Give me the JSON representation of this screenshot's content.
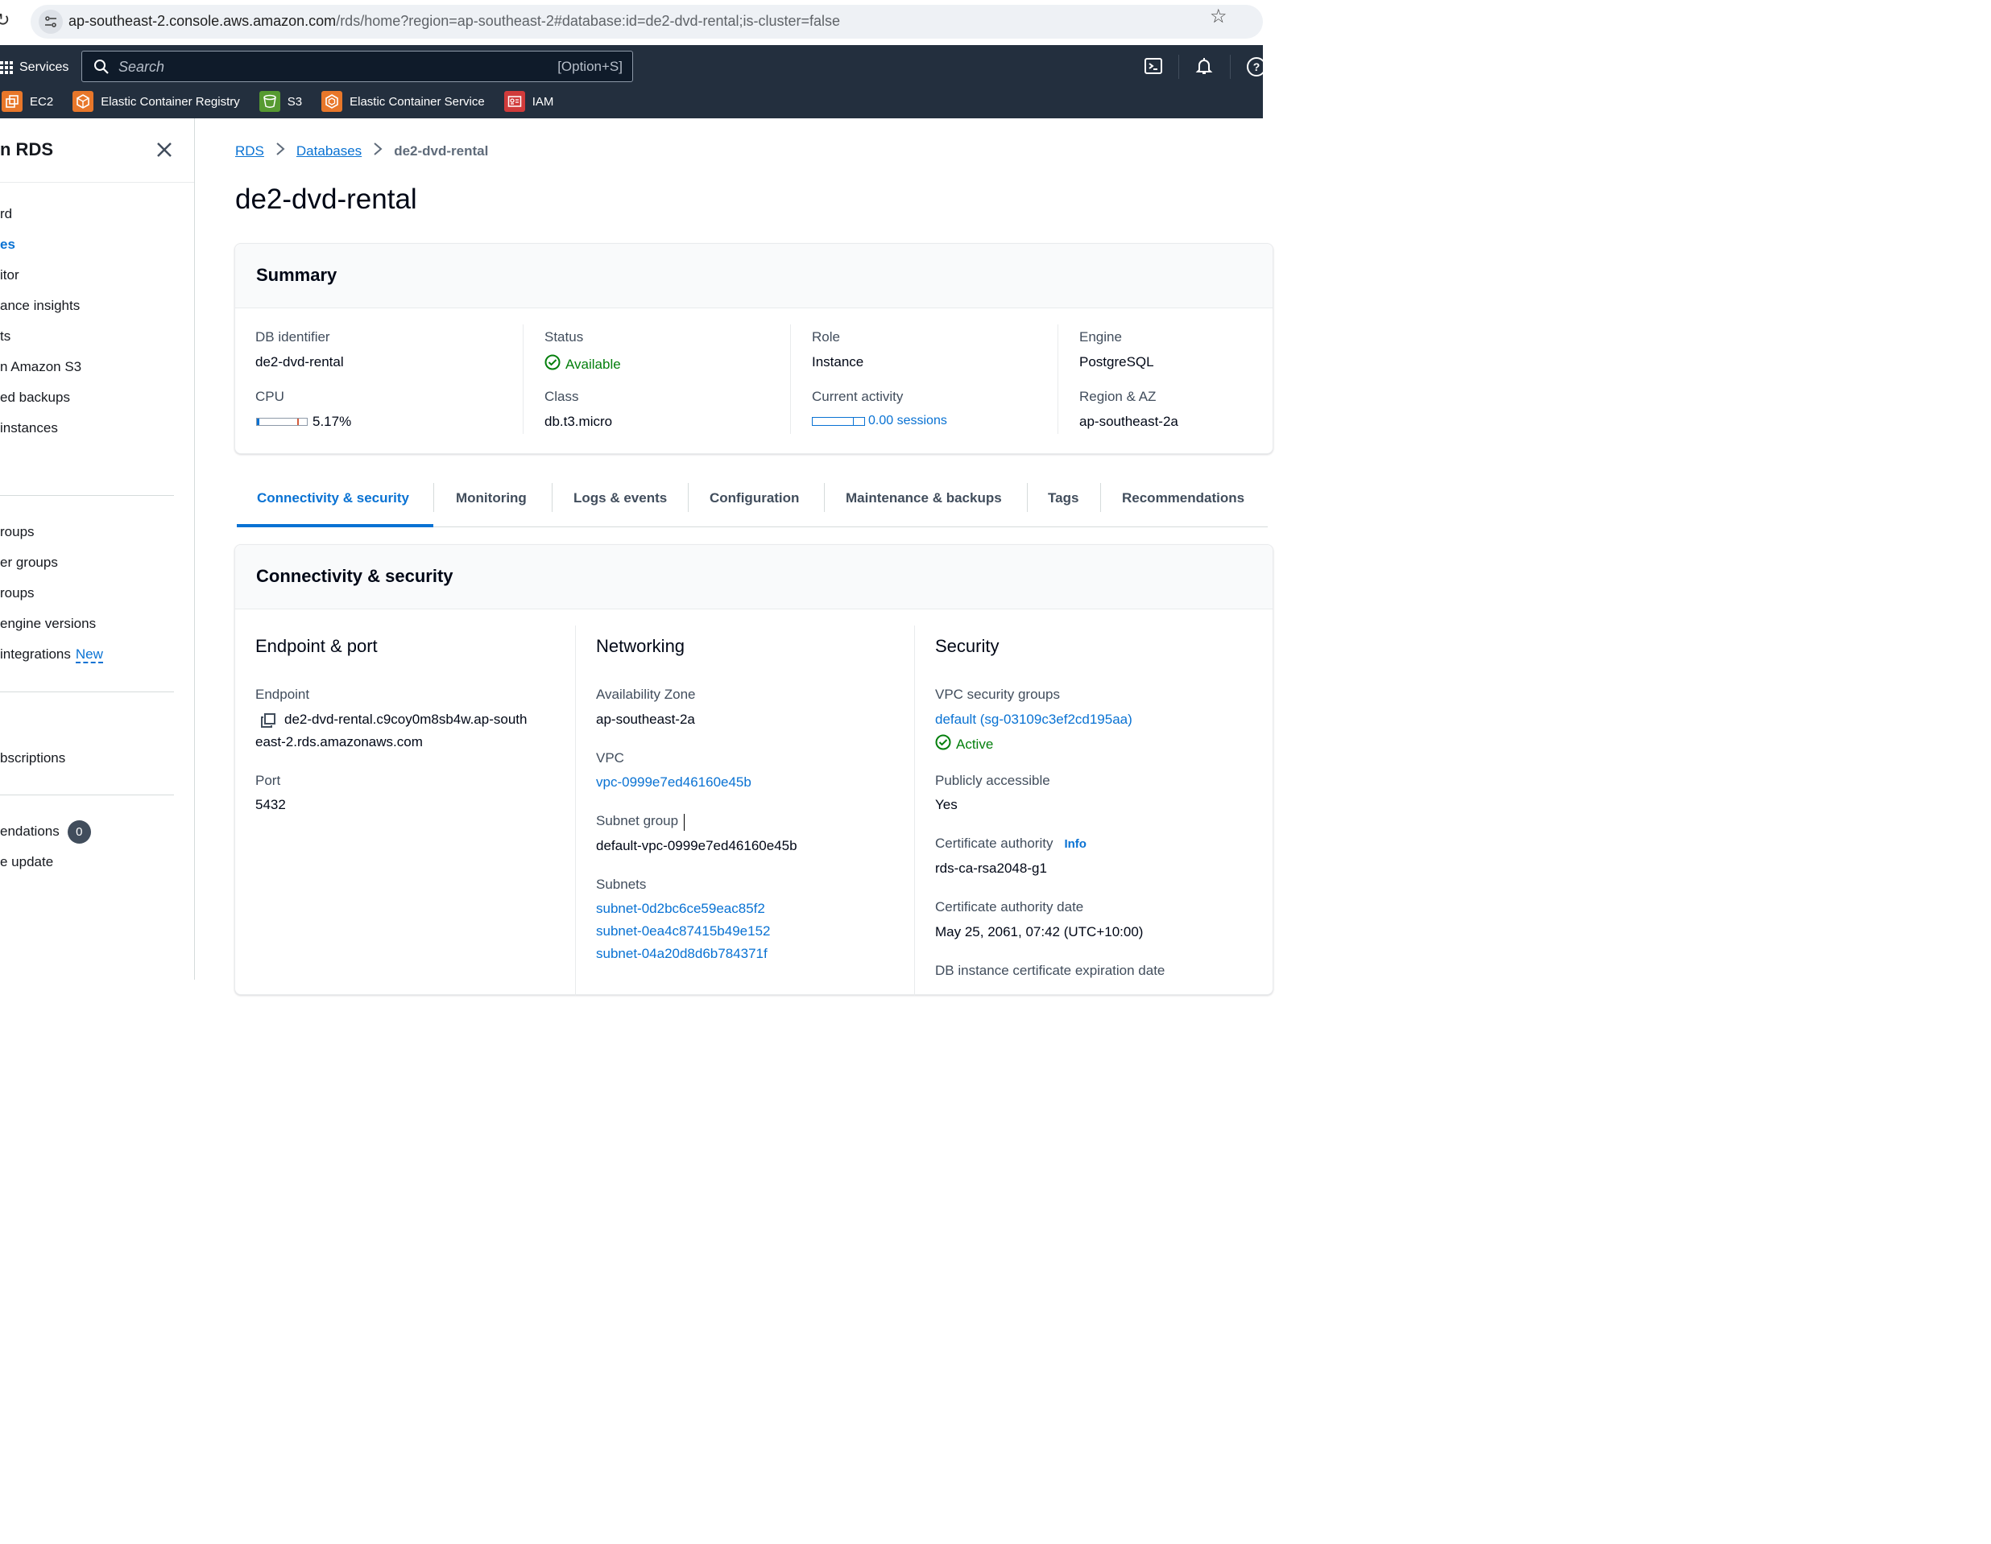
{
  "browser": {
    "url_host": "ap-southeast-2.console.aws.amazon.com",
    "url_path": "/rds/home?region=ap-southeast-2#database:id=de2-dvd-rental;is-cluster=false"
  },
  "topnav": {
    "services_label": "Services",
    "search_placeholder": "Search",
    "search_shortcut": "[Option+S]",
    "favorites": [
      {
        "label": "EC2",
        "icon": "ec2-icon"
      },
      {
        "label": "Elastic Container Registry",
        "icon": "ecr-icon"
      },
      {
        "label": "S3",
        "icon": "s3-bucket-icon"
      },
      {
        "label": "Elastic Container Service",
        "icon": "ecs-icon"
      },
      {
        "label": "IAM",
        "icon": "iam-icon"
      }
    ]
  },
  "sidebar": {
    "title": "n RDS",
    "items": [
      {
        "label": "rd"
      },
      {
        "label": "es",
        "active": true
      },
      {
        "label": "itor"
      },
      {
        "label": "ance insights"
      },
      {
        "label": "ts"
      },
      {
        "label": "n Amazon S3"
      },
      {
        "label": "ed backups"
      },
      {
        "label": " instances"
      },
      {
        "label": "roups"
      },
      {
        "label": "er groups"
      },
      {
        "label": "roups"
      },
      {
        "label": "engine versions"
      },
      {
        "label": " integrations",
        "badge": "New"
      },
      {
        "label": "bscriptions"
      },
      {
        "label": "endations",
        "count": "0"
      },
      {
        "label": "e update"
      }
    ]
  },
  "breadcrumb": {
    "rds": "RDS",
    "databases": "Databases",
    "current": "de2-dvd-rental"
  },
  "page_title": "de2-dvd-rental",
  "summary": {
    "title": "Summary",
    "db_identifier_label": "DB identifier",
    "db_identifier": "de2-dvd-rental",
    "cpu_label": "CPU",
    "cpu_value": "5.17%",
    "cpu_fraction": 0.0517,
    "status_label": "Status",
    "status": "Available",
    "class_label": "Class",
    "class": "db.t3.micro",
    "role_label": "Role",
    "role": "Instance",
    "activity_label": "Current activity",
    "activity": "0.00 sessions",
    "engine_label": "Engine",
    "engine": "PostgreSQL",
    "region_label": "Region & AZ",
    "region": "ap-southeast-2a"
  },
  "tabs": [
    "Connectivity & security",
    "Monitoring",
    "Logs & events",
    "Configuration",
    "Maintenance & backups",
    "Tags",
    "Recommendations"
  ],
  "connectivity": {
    "title": "Connectivity & security",
    "endpoint_section": "Endpoint & port",
    "endpoint_label": "Endpoint",
    "endpoint_line1": "de2-dvd-rental.c9coy0m8sb4w.ap-south",
    "endpoint_line2": "east-2.rds.amazonaws.com",
    "port_label": "Port",
    "port": "5432",
    "networking_section": "Networking",
    "az_label": "Availability Zone",
    "az": "ap-southeast-2a",
    "vpc_label": "VPC",
    "vpc": "vpc-0999e7ed46160e45b",
    "subnet_group_label": "Subnet group",
    "subnet_group": "default-vpc-0999e7ed46160e45b",
    "subnets_label": "Subnets",
    "subnets": [
      "subnet-0d2bc6ce59eac85f2",
      "subnet-0ea4c87415b49e152",
      "subnet-04a20d8d6b784371f"
    ],
    "security_section": "Security",
    "sg_label": "VPC security groups",
    "sg": "default (sg-03109c3ef2cd195aa)",
    "sg_status": "Active",
    "public_label": "Publicly accessible",
    "public": "Yes",
    "ca_label": "Certificate authority",
    "ca_info": "Info",
    "ca": "rds-ca-rsa2048-g1",
    "ca_date_label": "Certificate authority date",
    "ca_date": "May 25, 2061, 07:42 (UTC+10:00)",
    "cert_exp_label": "DB instance certificate expiration date"
  },
  "colors": {
    "nav_bg": "#232f3e",
    "link": "#0972d3",
    "success": "#037f0c"
  }
}
